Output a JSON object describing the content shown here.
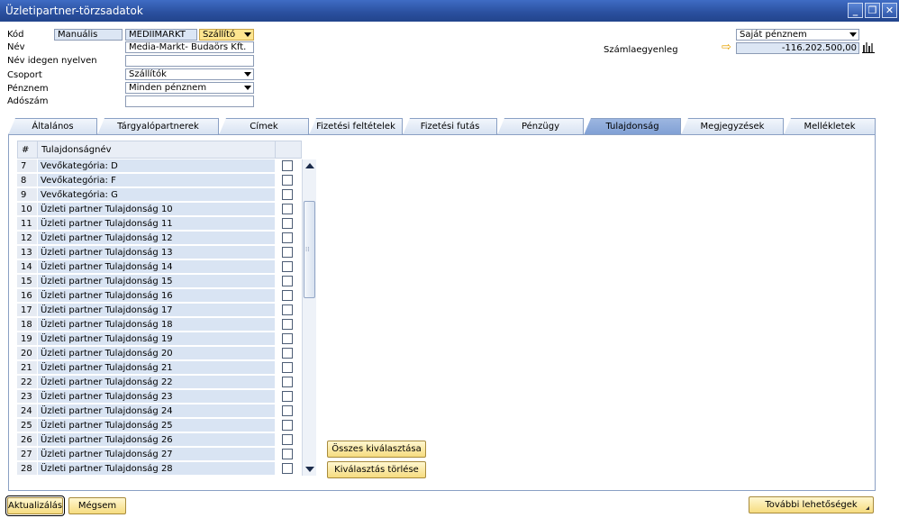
{
  "window": {
    "title": "Üzletipartner-törzsadatok"
  },
  "header": {
    "kod_label": "Kód",
    "kod_mode": "Manuális",
    "kod_value": "MEDIIMARKT",
    "kod_type": "Szállító",
    "nev_label": "Név",
    "nev_value": "Media-Markt- Budaörs Kft.",
    "nev_idegen_label": "Név idegen nyelven",
    "nev_idegen_value": "",
    "csoport_label": "Csoport",
    "csoport_value": "Szállítók",
    "penznem_label": "Pénznem",
    "penznem_value": "Minden pénznem",
    "adoszam_label": "Adószám",
    "adoszam_value": "",
    "currency_select": "Saját pénznem",
    "szamlaegyenleg_label": "Számlaegyenleg",
    "szamlaegyenleg_value": "-116.202.500,00"
  },
  "tabs": [
    {
      "label": "Általános",
      "active": false
    },
    {
      "label": "Tárgyalópartnerek",
      "active": false
    },
    {
      "label": "Címek",
      "active": false
    },
    {
      "label": "Fizetési feltételek",
      "active": false
    },
    {
      "label": "Fizetési futás",
      "active": false
    },
    {
      "label": "Pénzügy",
      "active": false
    },
    {
      "label": "Tulajdonság",
      "active": true
    },
    {
      "label": "Megjegyzések",
      "active": false
    },
    {
      "label": "Mellékletek",
      "active": false
    }
  ],
  "grid": {
    "col_num": "#",
    "col_name": "Tulajdonságnév",
    "rows": [
      {
        "num": "7",
        "name": "Vevőkategória: D"
      },
      {
        "num": "8",
        "name": "Vevőkategória: F"
      },
      {
        "num": "9",
        "name": "Vevőkategória: G"
      },
      {
        "num": "10",
        "name": "Üzleti partner Tulajdonság 10"
      },
      {
        "num": "11",
        "name": "Üzleti partner Tulajdonság 11"
      },
      {
        "num": "12",
        "name": "Üzleti partner Tulajdonság 12"
      },
      {
        "num": "13",
        "name": "Üzleti partner Tulajdonság 13"
      },
      {
        "num": "14",
        "name": "Üzleti partner Tulajdonság 14"
      },
      {
        "num": "15",
        "name": "Üzleti partner Tulajdonság 15"
      },
      {
        "num": "16",
        "name": "Üzleti partner Tulajdonság 16"
      },
      {
        "num": "17",
        "name": "Üzleti partner Tulajdonság 17"
      },
      {
        "num": "18",
        "name": "Üzleti partner Tulajdonság 18"
      },
      {
        "num": "19",
        "name": "Üzleti partner Tulajdonság 19"
      },
      {
        "num": "20",
        "name": "Üzleti partner Tulajdonság 20"
      },
      {
        "num": "21",
        "name": "Üzleti partner Tulajdonság 21"
      },
      {
        "num": "22",
        "name": "Üzleti partner Tulajdonság 22"
      },
      {
        "num": "23",
        "name": "Üzleti partner Tulajdonság 23"
      },
      {
        "num": "24",
        "name": "Üzleti partner Tulajdonság 24"
      },
      {
        "num": "25",
        "name": "Üzleti partner Tulajdonság 25"
      },
      {
        "num": "26",
        "name": "Üzleti partner Tulajdonság 26"
      },
      {
        "num": "27",
        "name": "Üzleti partner Tulajdonság 27"
      },
      {
        "num": "28",
        "name": "Üzleti partner Tulajdonság 28"
      }
    ]
  },
  "buttons": {
    "select_all": "Összes kiválasztása",
    "clear_selection": "Kiválasztás törlése",
    "update": "Aktualizálás",
    "cancel": "Mégsem",
    "more_options": "További lehetőségek"
  },
  "icons": {
    "arrow": "link-arrow-icon",
    "chart": "bar-chart-icon"
  }
}
